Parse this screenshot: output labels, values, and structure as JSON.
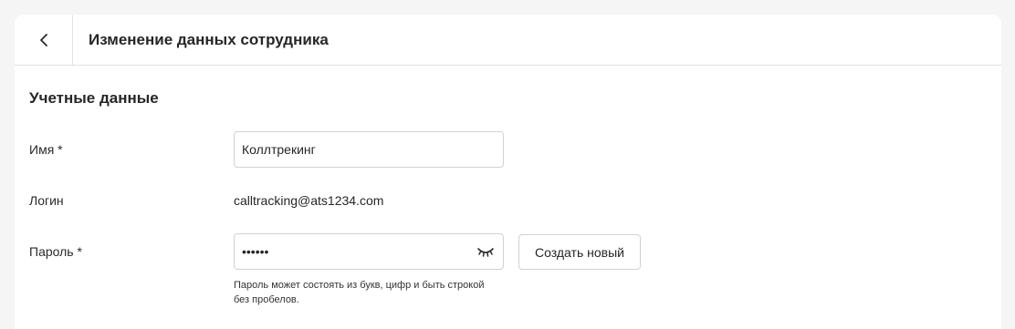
{
  "header": {
    "title": "Изменение данных сотрудника",
    "back_icon": "chevron-left-icon"
  },
  "section": {
    "title": "Учетные данные"
  },
  "form": {
    "name": {
      "label": "Имя *",
      "value": "Коллтрекинг"
    },
    "login": {
      "label": "Логин",
      "value": "calltracking@ats1234.com"
    },
    "password": {
      "label": "Пароль *",
      "value": "••••••",
      "visibility_icon": "eye-closed-icon",
      "generate_label": "Создать новый",
      "hint": "Пароль может состоять из букв, цифр и быть строкой без пробелов."
    }
  }
}
